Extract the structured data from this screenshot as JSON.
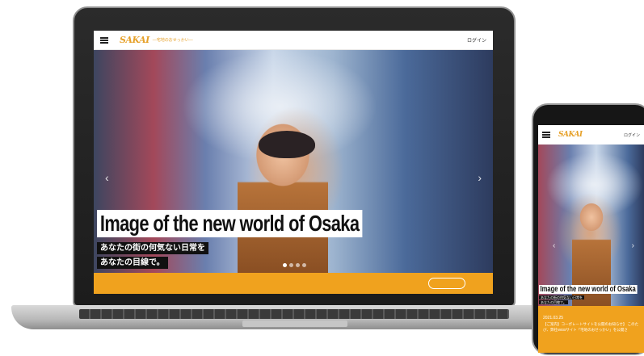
{
  "site": {
    "logo": "SAKAI",
    "tagline": "—宅地のおせっかい—",
    "login_label": "ログイン"
  },
  "hero": {
    "title": "Image of the new world of Osaka",
    "subtitle_lines": [
      "あなたの街の何気ない日常を",
      "あなたの目線で。"
    ],
    "prev_arrow": "‹",
    "next_arrow": "›",
    "slide_count": 4,
    "active_slide": 1
  },
  "phone": {
    "news_date": "2021.03.25",
    "news_text_lines": [
      "【ご案内】コーポレートサイトを公開のお知らせ】 このた",
      "び、弊社WEBサイト「宅地のおせっかい」を公開さ"
    ]
  },
  "colors": {
    "accent": "#f0a21e",
    "logo": "#e6a12a"
  },
  "icons": [
    "hamburger-menu-icon",
    "chevron-left-icon",
    "chevron-right-icon"
  ]
}
